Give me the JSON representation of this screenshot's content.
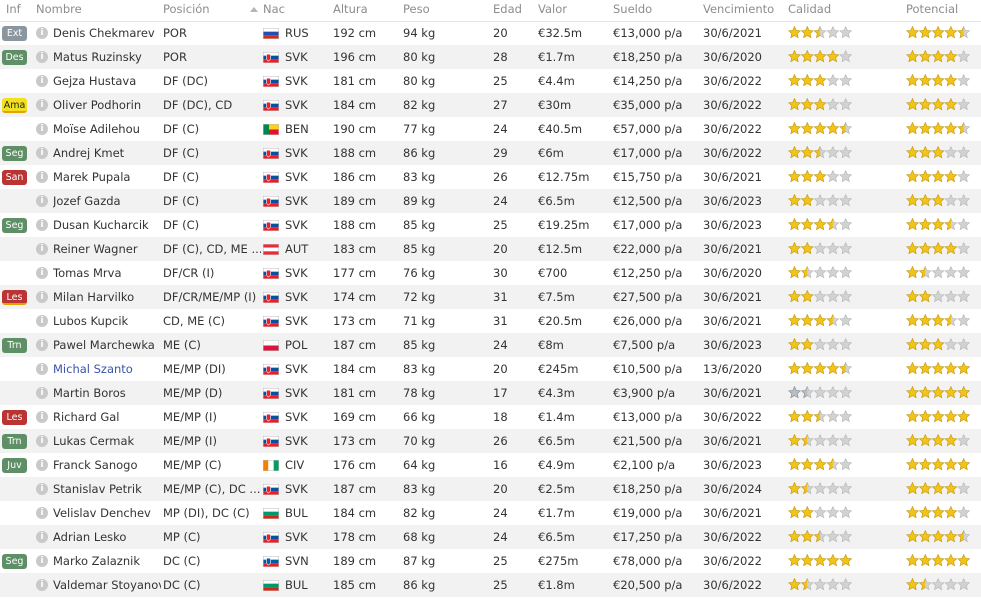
{
  "headers": [
    "Inf",
    "Nombre",
    "Posición",
    "Nac",
    "Altura",
    "Peso",
    "Edad",
    "Valor",
    "Sueldo",
    "Vencimiento",
    "Calidad",
    "Potencial"
  ],
  "players": [
    {
      "inf": "Ext",
      "inf_style": "grey",
      "name": "Denis Chekmarev",
      "pos": "POR",
      "nat": "RUS",
      "height": "192 cm",
      "weight": "94 kg",
      "age": "20",
      "value": "€32.5m",
      "wage": "€13,000 p/a",
      "expires": "30/6/2021",
      "quality": 2.5,
      "potential": 4.5,
      "quality_color": "gold",
      "potential_color": "gold"
    },
    {
      "inf": "Des",
      "inf_style": "green",
      "name": "Matus Ruzinsky",
      "pos": "POR",
      "nat": "SVK",
      "height": "196 cm",
      "weight": "80 kg",
      "age": "28",
      "value": "€1.7m",
      "wage": "€18,250 p/a",
      "expires": "30/6/2020",
      "quality": 4,
      "potential": 4,
      "quality_color": "gold",
      "potential_color": "gold"
    },
    {
      "inf": "",
      "inf_style": "",
      "name": "Gejza Hustava",
      "pos": "DF (DC)",
      "nat": "SVK",
      "height": "181 cm",
      "weight": "80 kg",
      "age": "25",
      "value": "€4.4m",
      "wage": "€14,250 p/a",
      "expires": "30/6/2022",
      "quality": 3,
      "potential": 4,
      "quality_color": "gold",
      "potential_color": "gold"
    },
    {
      "inf": "Ama",
      "inf_style": "yellow",
      "name": "Oliver Podhorin",
      "pos": "DF (DC), CD",
      "nat": "SVK",
      "height": "184 cm",
      "weight": "82 kg",
      "age": "27",
      "value": "€30m",
      "wage": "€35,000 p/a",
      "expires": "30/6/2022",
      "quality": 3,
      "potential": 4,
      "quality_color": "gold",
      "potential_color": "gold"
    },
    {
      "inf": "",
      "inf_style": "",
      "name": "Moïse Adilehou",
      "pos": "DF (C)",
      "nat": "BEN",
      "height": "190 cm",
      "weight": "77 kg",
      "age": "24",
      "value": "€40.5m",
      "wage": "€57,000 p/a",
      "expires": "30/6/2022",
      "quality": 4.5,
      "potential": 4.5,
      "quality_color": "gold",
      "potential_color": "gold"
    },
    {
      "inf": "Seg",
      "inf_style": "green",
      "name": "Andrej Kmet",
      "pos": "DF (C)",
      "nat": "SVK",
      "height": "188 cm",
      "weight": "86 kg",
      "age": "29",
      "value": "€6m",
      "wage": "€17,000 p/a",
      "expires": "30/6/2022",
      "quality": 2.5,
      "potential": 3,
      "quality_color": "gold",
      "potential_color": "gold"
    },
    {
      "inf": "San",
      "inf_style": "red",
      "name": "Marek Pupala",
      "pos": "DF (C)",
      "nat": "SVK",
      "height": "186 cm",
      "weight": "83 kg",
      "age": "26",
      "value": "€12.75m",
      "wage": "€15,750 p/a",
      "expires": "30/6/2021",
      "quality": 3,
      "potential": 4,
      "quality_color": "gold",
      "potential_color": "gold"
    },
    {
      "inf": "",
      "inf_style": "",
      "name": "Jozef Gazda",
      "pos": "DF (C)",
      "nat": "SVK",
      "height": "189 cm",
      "weight": "89 kg",
      "age": "24",
      "value": "€6.5m",
      "wage": "€12,500 p/a",
      "expires": "30/6/2023",
      "quality": 2,
      "potential": 3,
      "quality_color": "gold",
      "potential_color": "gold"
    },
    {
      "inf": "Seg",
      "inf_style": "green",
      "name": "Dusan Kucharcik",
      "pos": "DF (C)",
      "nat": "SVK",
      "height": "188 cm",
      "weight": "85 kg",
      "age": "25",
      "value": "€19.25m",
      "wage": "€17,000 p/a",
      "expires": "30/6/2023",
      "quality": 3.5,
      "potential": 3.5,
      "quality_color": "gold",
      "potential_color": "gold"
    },
    {
      "inf": "",
      "inf_style": "",
      "name": "Reiner Wagner",
      "pos": "DF (C), CD, ME ...",
      "nat": "AUT",
      "height": "183 cm",
      "weight": "85 kg",
      "age": "20",
      "value": "€12.5m",
      "wage": "€22,000 p/a",
      "expires": "30/6/2021",
      "quality": 2,
      "potential": 4,
      "quality_color": "gold",
      "potential_color": "gold"
    },
    {
      "inf": "",
      "inf_style": "",
      "name": "Tomas Mrva",
      "pos": "DF/CR (I)",
      "nat": "SVK",
      "height": "177 cm",
      "weight": "76 kg",
      "age": "30",
      "value": "€700",
      "wage": "€12,250 p/a",
      "expires": "30/6/2020",
      "quality": 1.5,
      "potential": 1.5,
      "quality_color": "gold",
      "potential_color": "gold"
    },
    {
      "inf": "Les",
      "inf_style": "redy",
      "name": "Milan Harvilko",
      "pos": "DF/CR/ME/MP (I)",
      "nat": "SVK",
      "height": "174 cm",
      "weight": "72 kg",
      "age": "31",
      "value": "€7.5m",
      "wage": "€27,500 p/a",
      "expires": "30/6/2021",
      "quality": 2,
      "potential": 2,
      "quality_color": "gold",
      "potential_color": "gold"
    },
    {
      "inf": "",
      "inf_style": "",
      "name": "Lubos Kupcik",
      "pos": "CD, ME (C)",
      "nat": "SVK",
      "height": "173 cm",
      "weight": "71 kg",
      "age": "31",
      "value": "€20.5m",
      "wage": "€26,000 p/a",
      "expires": "30/6/2021",
      "quality": 3.5,
      "potential": 3.5,
      "quality_color": "gold",
      "potential_color": "gold"
    },
    {
      "inf": "Trn",
      "inf_style": "green",
      "name": "Pawel Marchewka",
      "pos": "ME (C)",
      "nat": "POL",
      "height": "187 cm",
      "weight": "85 kg",
      "age": "24",
      "value": "€8m",
      "wage": "€7,500 p/a",
      "expires": "30/6/2023",
      "quality": 2,
      "potential": 3,
      "quality_color": "gold",
      "potential_color": "gold"
    },
    {
      "inf": "",
      "inf_style": "",
      "name": "Michal Szanto",
      "pos": "ME/MP (DI)",
      "nat": "SVK",
      "height": "184 cm",
      "weight": "83 kg",
      "age": "20",
      "value": "€245m",
      "wage": "€10,500 p/a",
      "expires": "13/6/2020",
      "quality": 4.5,
      "potential": 5,
      "quality_color": "gold",
      "potential_color": "gold",
      "highlight": true
    },
    {
      "inf": "",
      "inf_style": "",
      "name": "Martin Boros",
      "pos": "ME/MP (D)",
      "nat": "SVK",
      "height": "181 cm",
      "weight": "78 kg",
      "age": "17",
      "value": "€4.3m",
      "wage": "€3,900 p/a",
      "expires": "30/6/2021",
      "quality": 1.5,
      "potential": 5,
      "quality_color": "silver",
      "potential_color": "gold"
    },
    {
      "inf": "Les",
      "inf_style": "red",
      "name": "Richard Gal",
      "pos": "ME/MP (I)",
      "nat": "SVK",
      "height": "169 cm",
      "weight": "66 kg",
      "age": "18",
      "value": "€1.4m",
      "wage": "€13,000 p/a",
      "expires": "30/6/2022",
      "quality": 2.5,
      "potential": 5,
      "quality_color": "gold",
      "potential_color": "gold"
    },
    {
      "inf": "Trn",
      "inf_style": "green",
      "name": "Lukas Cermak",
      "pos": "ME/MP (I)",
      "nat": "SVK",
      "height": "173 cm",
      "weight": "70 kg",
      "age": "26",
      "value": "€6.5m",
      "wage": "€21,500 p/a",
      "expires": "30/6/2021",
      "quality": 1.5,
      "potential": 4,
      "quality_color": "gold",
      "potential_color": "gold"
    },
    {
      "inf": "Juv",
      "inf_style": "green",
      "name": "Franck Sanogo",
      "pos": "ME/MP (C)",
      "nat": "CIV",
      "height": "176 cm",
      "weight": "64 kg",
      "age": "16",
      "value": "€4.9m",
      "wage": "€2,100 p/a",
      "expires": "30/6/2023",
      "quality": 3.5,
      "potential": 5,
      "quality_color": "gold",
      "potential_color": "gold"
    },
    {
      "inf": "",
      "inf_style": "",
      "name": "Stanislav Petrik",
      "pos": "ME/MP (C), DC ...",
      "nat": "SVK",
      "height": "187 cm",
      "weight": "83 kg",
      "age": "20",
      "value": "€2.5m",
      "wage": "€18,250 p/a",
      "expires": "30/6/2024",
      "quality": 1.5,
      "potential": 4,
      "quality_color": "gold",
      "potential_color": "gold"
    },
    {
      "inf": "",
      "inf_style": "",
      "name": "Velislav Denchev",
      "pos": "MP (DI), DC (C)",
      "nat": "BUL",
      "height": "184 cm",
      "weight": "82 kg",
      "age": "24",
      "value": "€1.7m",
      "wage": "€19,000 p/a",
      "expires": "30/6/2021",
      "quality": 2,
      "potential": 4,
      "quality_color": "gold",
      "potential_color": "gold"
    },
    {
      "inf": "",
      "inf_style": "",
      "name": "Adrian Lesko",
      "pos": "MP (C)",
      "nat": "SVK",
      "height": "178 cm",
      "weight": "68 kg",
      "age": "24",
      "value": "€6.5m",
      "wage": "€17,250 p/a",
      "expires": "30/6/2022",
      "quality": 2.5,
      "potential": 4.5,
      "quality_color": "gold",
      "potential_color": "gold"
    },
    {
      "inf": "Seg",
      "inf_style": "green",
      "name": "Marko Zalaznik",
      "pos": "DC (C)",
      "nat": "SVN",
      "height": "189 cm",
      "weight": "87 kg",
      "age": "25",
      "value": "€275m",
      "wage": "€78,000 p/a",
      "expires": "30/6/2022",
      "quality": 5,
      "potential": 5,
      "quality_color": "gold",
      "potential_color": "gold"
    },
    {
      "inf": "",
      "inf_style": "",
      "name": "Valdemar Stoyanov",
      "pos": "DC (C)",
      "nat": "BUL",
      "height": "185 cm",
      "weight": "86 kg",
      "age": "25",
      "value": "€1.8m",
      "wage": "€20,500 p/a",
      "expires": "30/6/2022",
      "quality": 1.5,
      "potential": 1.5,
      "quality_color": "gold",
      "potential_color": "gold"
    }
  ],
  "flags": {
    "RUS": [
      "#ffffff",
      "#1f4fb0",
      "#d52b1e"
    ],
    "SVK": [
      "#ffffff",
      "#0b4ea2",
      "#ee1c25"
    ],
    "BEN": "benin",
    "AUT": [
      "#ed2939",
      "#ffffff",
      "#ed2939"
    ],
    "POL": [
      "#ffffff",
      "#dc143c"
    ],
    "CIV": "civ",
    "BUL": [
      "#ffffff",
      "#00966e",
      "#d62612"
    ],
    "SVN": [
      "#ffffff",
      "#005da4",
      "#ed1c24"
    ]
  },
  "colors": {
    "gold": "#f3c418",
    "gold_stroke": "#c99a06",
    "silver": "#b8bec6",
    "silver_stroke": "#8a9098",
    "empty": "#d2d2d2",
    "empty_stroke": "#b5b5b5"
  }
}
